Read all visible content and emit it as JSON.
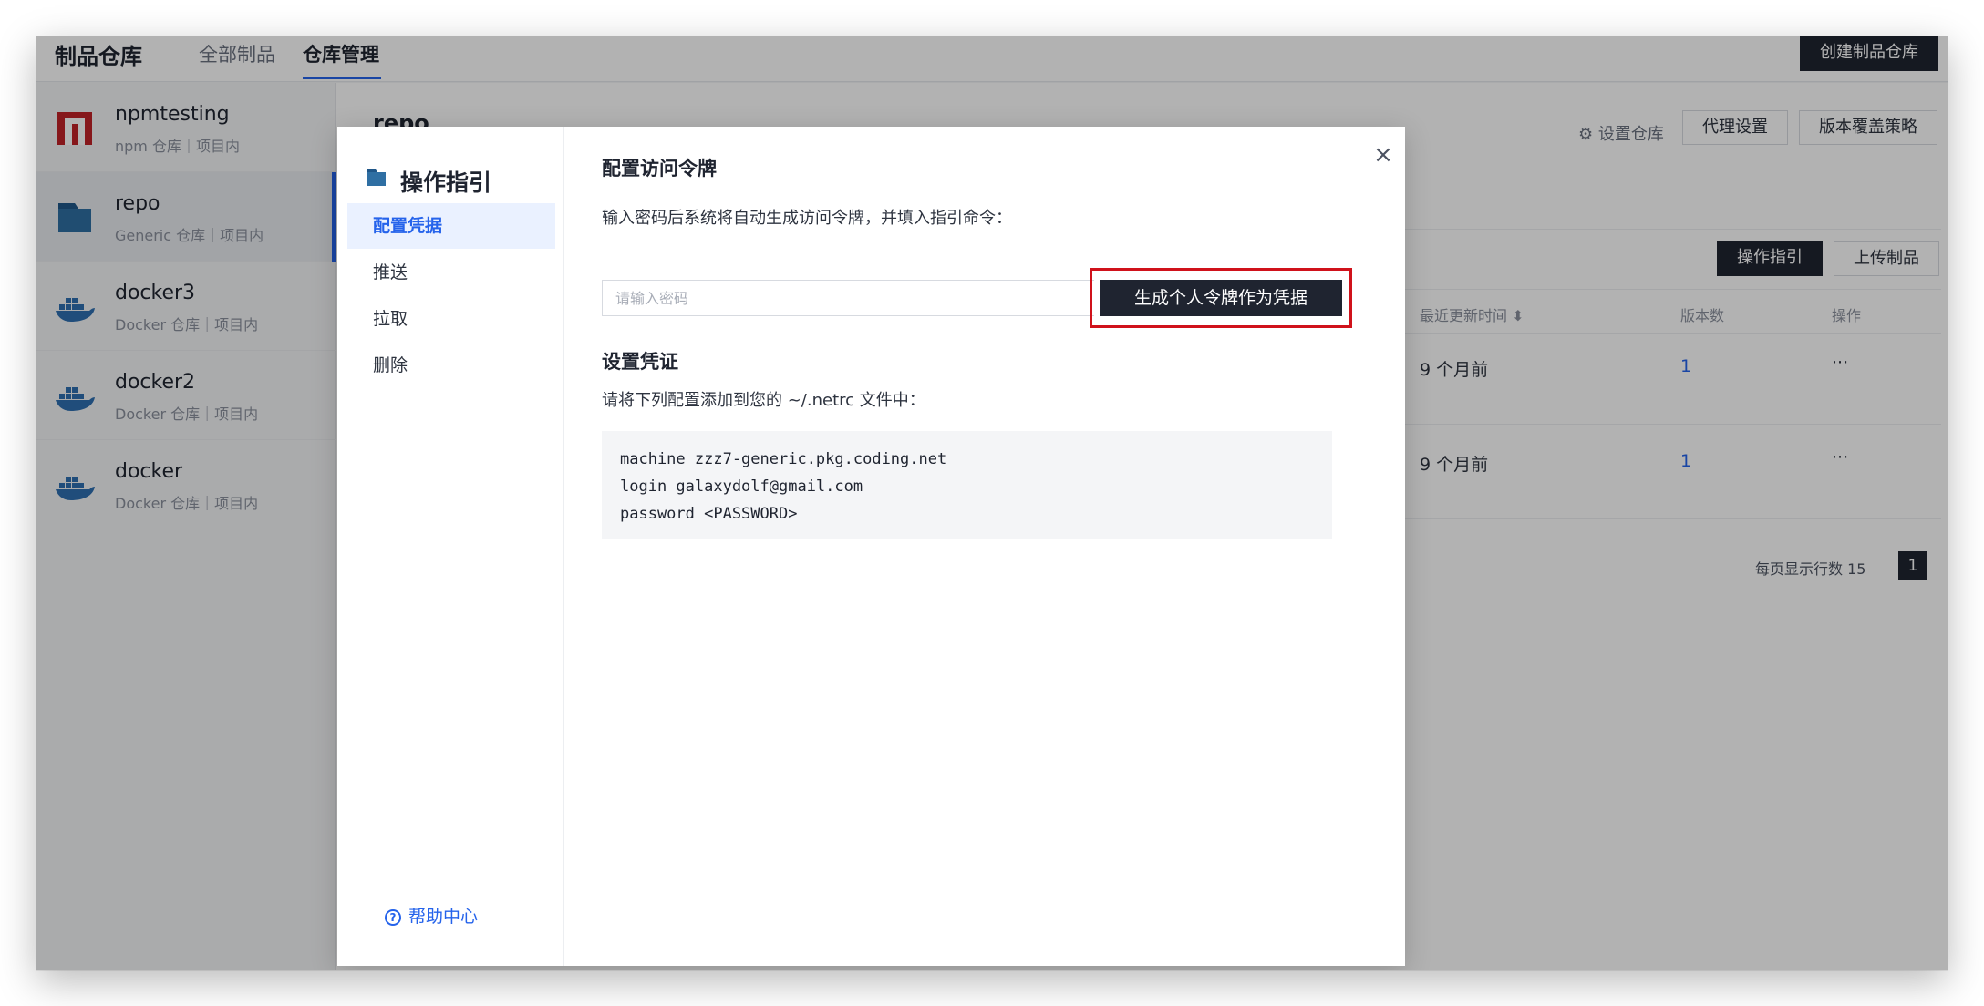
{
  "topbar": {
    "brand": "制品仓库",
    "tabs": [
      {
        "label": "全部制品"
      },
      {
        "label": "仓库管理"
      }
    ],
    "create_button": "创建制品仓库"
  },
  "repos": [
    {
      "name": "npmtesting",
      "meta": "npm 仓库｜项目内",
      "icon": "npm-icon"
    },
    {
      "name": "repo",
      "meta": "Generic 仓库｜项目内",
      "icon": "folder-icon"
    },
    {
      "name": "docker3",
      "meta": "Docker 仓库｜项目内",
      "icon": "docker-icon"
    },
    {
      "name": "docker2",
      "meta": "Docker 仓库｜项目内",
      "icon": "docker-icon"
    },
    {
      "name": "docker",
      "meta": "Docker 仓库｜项目内",
      "icon": "docker-icon"
    }
  ],
  "main": {
    "repo_title": "repo",
    "settings_link": "设置仓库",
    "proxy_button": "代理设置",
    "version_policy_button": "版本覆盖策略",
    "guide_button": "操作指引",
    "upload_button": "上传制品",
    "columns": [
      "最近更新时间 ⬍",
      "版本数",
      "操作"
    ],
    "rows": [
      {
        "updated": "9 个月前",
        "versions": "1",
        "action": "···"
      },
      {
        "updated": "9 个月前",
        "versions": "1",
        "action": "···"
      }
    ],
    "page_size_label": "每页显示行数 15",
    "page_current": "1"
  },
  "modal": {
    "title": "操作指引",
    "nav": [
      {
        "label": "配置凭据"
      },
      {
        "label": "推送"
      },
      {
        "label": "拉取"
      },
      {
        "label": "删除"
      }
    ],
    "help_label": "帮助中心",
    "close_symbol": "×",
    "token_section": {
      "title": "配置访问令牌",
      "description": "输入密码后系统将自动生成访问令牌，并填入指引命令：",
      "password_placeholder": "请输入密码",
      "password_value": "",
      "generate_button": "生成个人令牌作为凭据"
    },
    "credential_section": {
      "title": "设置凭证",
      "description": "请将下列配置添加到您的 ~/.netrc 文件中：",
      "code_lines": [
        "machine zzz7-generic.pkg.coding.net",
        "login galaxydolf@gmail.com",
        "password <PASSWORD>"
      ]
    }
  },
  "colors": {
    "accent": "#2563eb",
    "dark_button": "#1f2430",
    "highlight": "#d0121b"
  }
}
